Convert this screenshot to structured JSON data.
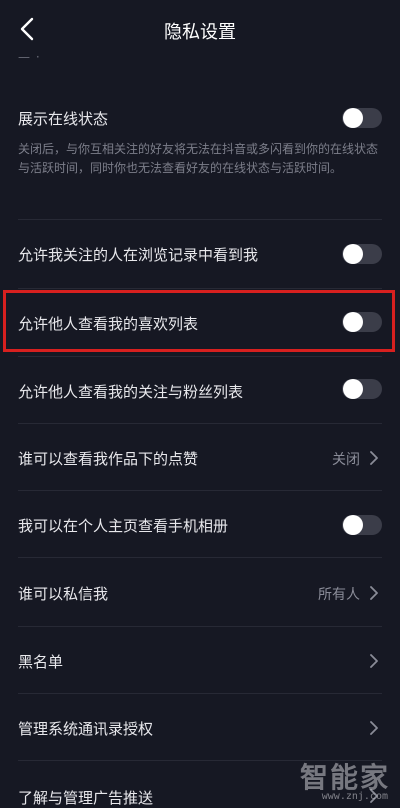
{
  "header": {
    "title": "隐私设置",
    "partial_top_text": "— ·"
  },
  "rows": [
    {
      "label": "展示在线状态",
      "description": "关闭后，与你互相关注的好友将无法在抖音或多闪看到你的在线状态与活跃时间，同时你也无法查看好友的在线状态与活跃时间。",
      "toggle_on": false
    },
    {
      "label": "允许我关注的人在浏览记录中看到我",
      "toggle_on": false
    },
    {
      "label": "允许他人查看我的喜欢列表",
      "toggle_on": false
    },
    {
      "label": "允许他人查看我的关注与粉丝列表",
      "toggle_on": false
    },
    {
      "label": "谁可以查看我作品下的点赞",
      "value": "关闭"
    },
    {
      "label": "我可以在个人主页查看手机相册",
      "toggle_on": false
    },
    {
      "label": "谁可以私信我",
      "value": "所有人"
    },
    {
      "label": "黑名单"
    },
    {
      "label": "管理系统通讯录授权"
    },
    {
      "label": "了解与管理广告推送"
    }
  ],
  "watermark": {
    "main": "智能家",
    "sub": "www.znj.com"
  },
  "colors": {
    "background": "#161823",
    "highlight_border": "#d8201f",
    "toggle_off": "#3b3d49"
  }
}
